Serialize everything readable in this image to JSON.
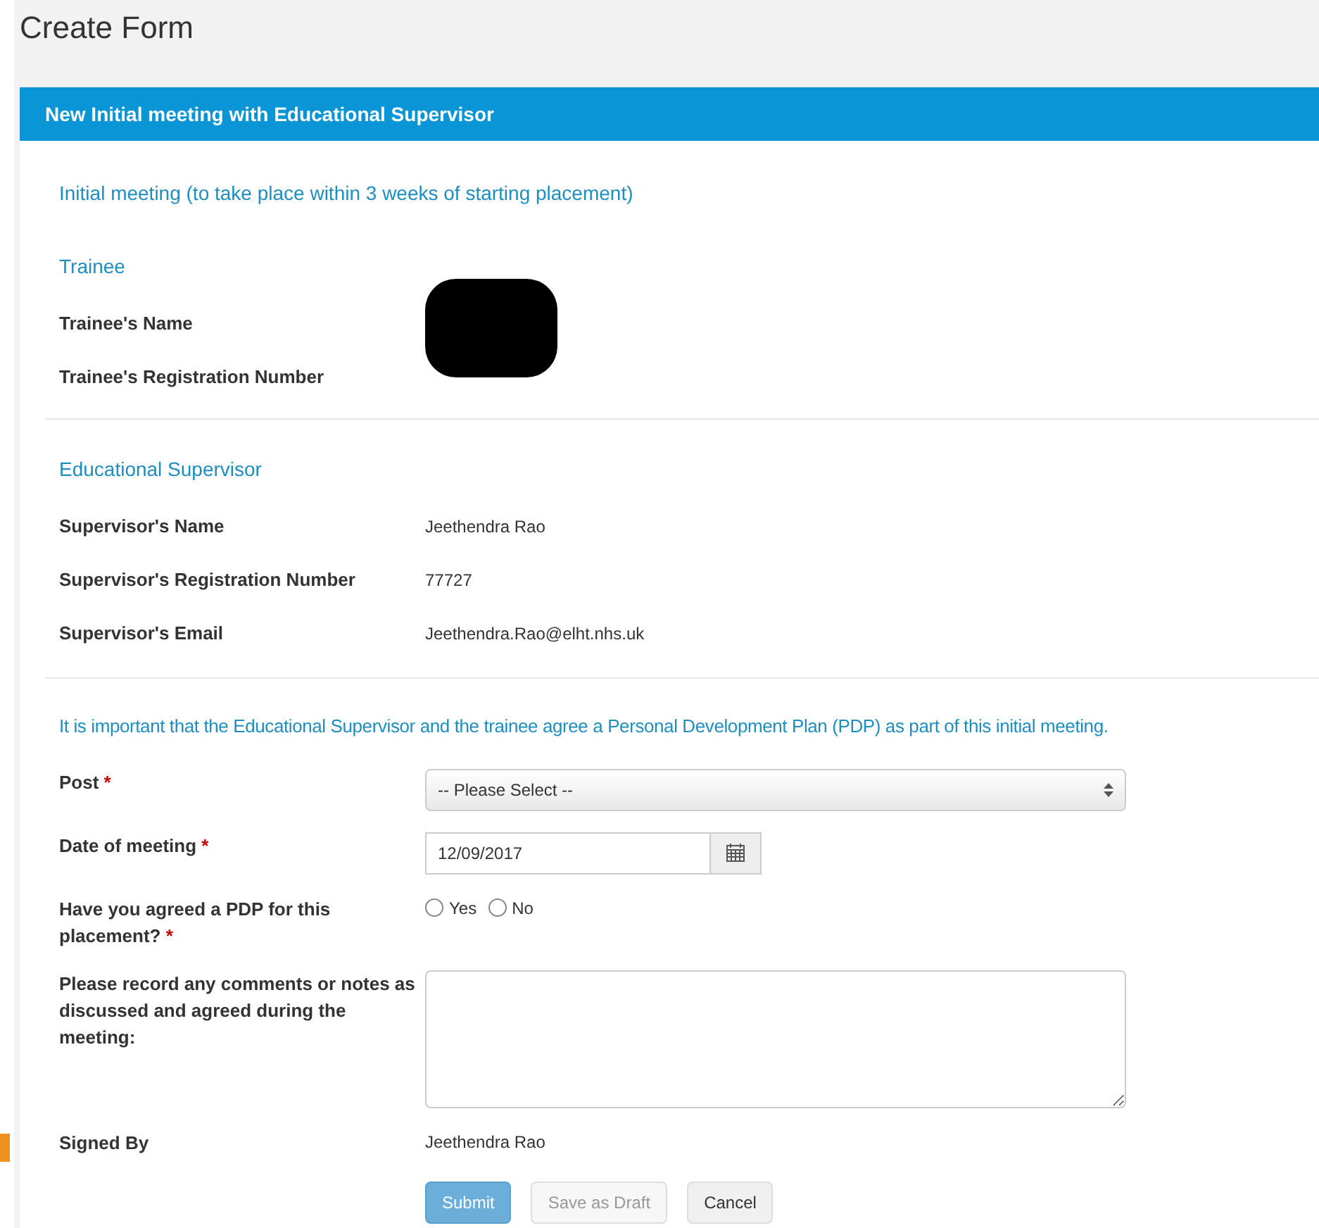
{
  "page_title": "Create Form",
  "panel": {
    "title": "New Initial meeting with Educational Supervisor",
    "intro": "Initial meeting (to take place within 3 weeks of starting placement)",
    "sections": [
      {
        "heading": "Trainee",
        "redacted": true,
        "rows": [
          {
            "label": "Trainee's Name"
          },
          {
            "label": "Trainee's Registration Number"
          }
        ]
      },
      {
        "heading": "Educational Supervisor",
        "redacted": false,
        "rows": [
          {
            "label": "Supervisor's Name",
            "value": "Jeethendra Rao"
          },
          {
            "label": "Supervisor's Registration Number",
            "value": "77727"
          },
          {
            "label": "Supervisor's Email",
            "value": "Jeethendra.Rao@elht.nhs.uk"
          }
        ]
      }
    ],
    "note": "It is important that the Educational Supervisor and the trainee agree a Personal Development Plan (PDP) as part of this initial meeting.",
    "fields": [
      {
        "kind": "select",
        "label": "Post",
        "required_mark": "*",
        "value": "-- Please Select --"
      },
      {
        "kind": "date",
        "label": "Date of meeting",
        "required_mark": "*",
        "value": "12/09/2017"
      },
      {
        "kind": "radio",
        "label": "Have you agreed a PDP for this placement?",
        "required_mark": "*",
        "options": [
          {
            "label": "Yes",
            "selected": false
          },
          {
            "label": "No",
            "selected": false
          }
        ]
      },
      {
        "kind": "textarea",
        "label": "Please record any comments or notes as discussed and agreed during the meeting:"
      },
      {
        "kind": "text",
        "label": "Signed By",
        "value": "Jeethendra Rao"
      }
    ],
    "buttons": [
      {
        "kind": "primary",
        "label": "Submit",
        "disabled": false
      },
      {
        "kind": "default",
        "label": "Save as Draft",
        "disabled": true
      },
      {
        "kind": "default",
        "label": "Cancel",
        "disabled": false
      }
    ]
  }
}
